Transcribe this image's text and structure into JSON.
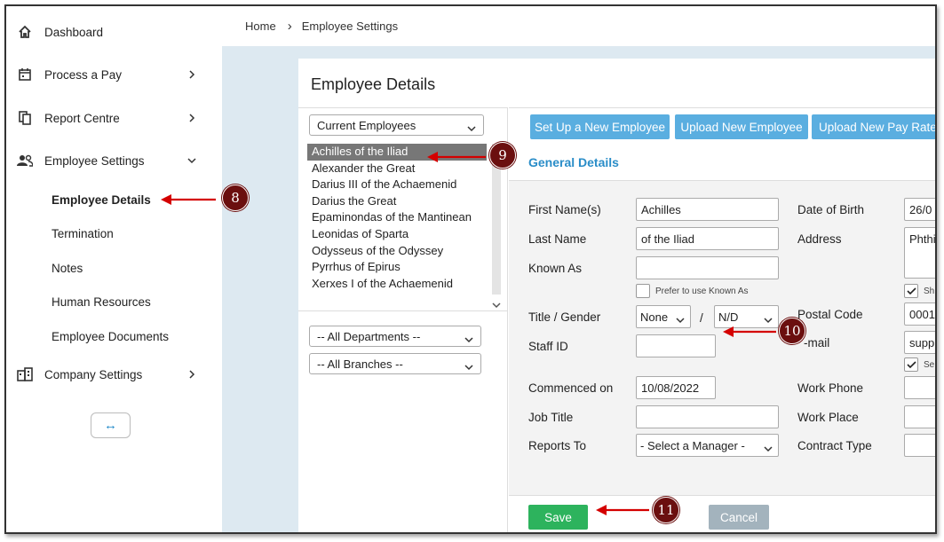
{
  "sidebar": {
    "items": [
      {
        "label": "Dashboard",
        "icon": "home-icon"
      },
      {
        "label": "Process a Pay",
        "icon": "calendar-icon"
      },
      {
        "label": "Report Centre",
        "icon": "documents-icon"
      },
      {
        "label": "Employee Settings",
        "icon": "people-icon"
      },
      {
        "label": "Company Settings",
        "icon": "building-icon"
      }
    ],
    "subitems": [
      "Employee Details",
      "Termination",
      "Notes",
      "Human Resources",
      "Employee Documents"
    ],
    "collapse_symbol": "↔"
  },
  "breadcrumb": {
    "home": "Home",
    "separator": "›",
    "current": "Employee Settings"
  },
  "card": {
    "title": "Employee Details"
  },
  "filters": {
    "employment": "Current Employees",
    "department": "-- All Departments --",
    "branch": "-- All Branches --"
  },
  "employees": [
    "Achilles of the Iliad",
    "Alexander the Great",
    "Darius III of the Achaemenid",
    "Darius the Great",
    "Epaminondas of the Mantinean",
    "Leonidas of Sparta",
    "Odysseus of the Odyssey",
    "Pyrrhus of Epirus",
    "Xerxes I of the Achaemenid"
  ],
  "toolbar": {
    "setup": "Set Up a New Employee",
    "upload": "Upload New Employee",
    "pay_rate": "Upload New Pay Rate"
  },
  "section": {
    "title": "General Details"
  },
  "form": {
    "first_name_label": "First Name(s)",
    "first_name": "Achilles",
    "last_name_label": "Last Name",
    "last_name": "of the Iliad",
    "known_as_label": "Known As",
    "known_as": "",
    "prefer_known_as": "Prefer to use Known As",
    "title_gender_label": "Title / Gender",
    "title": "None",
    "slash": "/",
    "gender": "N/D",
    "staff_id_label": "Staff ID",
    "staff_id": "",
    "commenced_label": "Commenced on",
    "commenced": "10/08/2022",
    "job_title_label": "Job Title",
    "job_title": "",
    "reports_to_label": "Reports To",
    "reports_to": "- Select a Manager -",
    "dob_label": "Date of Birth",
    "dob": "26/0",
    "address_label": "Address",
    "address": "Phthi",
    "address_check": "Sh",
    "postal_code_label": "Postal Code",
    "postal_code": "0001",
    "email_label": "-mail",
    "email": "supp",
    "email_check": "Se",
    "work_phone_label": "Work Phone",
    "work_place_label": "Work Place",
    "contract_type_label": "Contract Type"
  },
  "footer": {
    "save": "Save",
    "cancel": "Cancel"
  },
  "annotations": [
    "8",
    "9",
    "10",
    "11"
  ],
  "colors": {
    "accent": "#5aaee0",
    "save": "#2db35d",
    "cancel": "#a3b3bd",
    "badge": "#6b0f0f",
    "arrow": "#d40000"
  }
}
